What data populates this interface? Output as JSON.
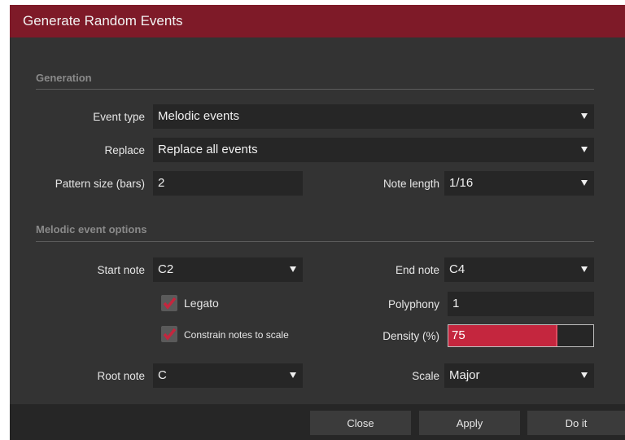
{
  "dialog": {
    "title": "Generate Random Events"
  },
  "generation": {
    "heading": "Generation",
    "event_type": {
      "label": "Event type",
      "value": "Melodic events"
    },
    "replace": {
      "label": "Replace",
      "value": "Replace all events"
    },
    "pattern_size": {
      "label": "Pattern size (bars)",
      "value": "2"
    },
    "note_length": {
      "label": "Note length",
      "value": "1/16"
    }
  },
  "melodic": {
    "heading": "Melodic event options",
    "start_note": {
      "label": "Start note",
      "value": "C2"
    },
    "end_note": {
      "label": "End note",
      "value": "C4"
    },
    "legato": {
      "label": "Legato",
      "checked": true
    },
    "polyphony": {
      "label": "Polyphony",
      "value": "1"
    },
    "constrain": {
      "label": "Constrain notes to scale",
      "checked": true
    },
    "density": {
      "label": "Density (%)",
      "value": "75",
      "percent": 75
    },
    "root_note": {
      "label": "Root note",
      "value": "C"
    },
    "scale": {
      "label": "Scale",
      "value": "Major"
    }
  },
  "buttons": {
    "close": "Close",
    "apply": "Apply",
    "doit": "Do it"
  },
  "colors": {
    "title_bar": "#7e1a28",
    "accent": "#c4263e",
    "panel": "#333333",
    "field": "#262626"
  }
}
